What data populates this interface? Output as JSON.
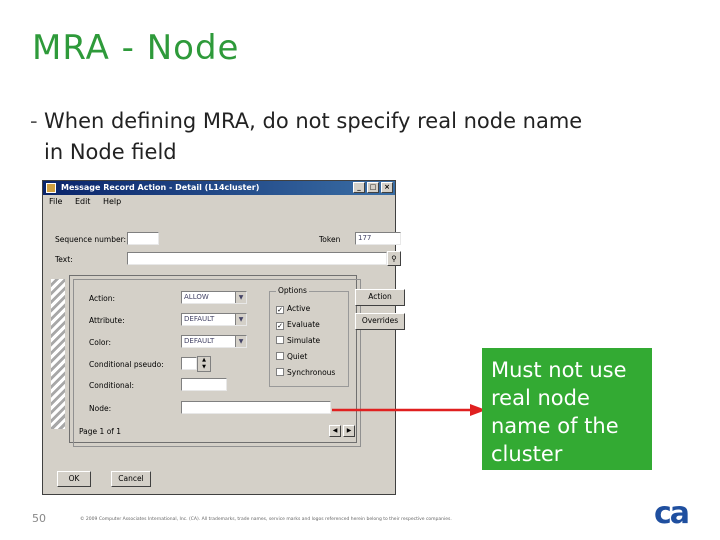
{
  "slide": {
    "title": "MRA - Node",
    "bullet_dash": "-",
    "bullet_line1": "When defining MRA, do not specify real node name",
    "bullet_line2": "in Node field",
    "page_number": "50",
    "footer": "© 2009 Computer Associates International, Inc. (CA). All trademarks, trade names, service marks and logos referenced herein belong to their respective companies.",
    "logo_text": "ca",
    "callout": "Must not use real node name of the cluster"
  },
  "window": {
    "title": "Message Record Action - Detail (L14cluster)",
    "controls": {
      "minimize": "_",
      "maximize": "□",
      "close": "×"
    },
    "menu": [
      "File",
      "Edit",
      "Help"
    ],
    "labels": {
      "sequence_number": "Sequence number:",
      "token": "Token",
      "text": "Text:",
      "action": "Action:",
      "attribute": "Attribute:",
      "color": "Color:",
      "condition_pseudo": "Conditional pseudo:",
      "condition": "Conditional:",
      "node": "Node:",
      "page": "Page 1 of 1"
    },
    "values": {
      "sequence_number": "",
      "token": "177",
      "text": "",
      "action": "ALLOW",
      "attribute": "DEFAULT",
      "color": "DEFAULT",
      "condition": "",
      "node": ""
    },
    "options": {
      "title": "Options",
      "items": [
        {
          "label": "Active",
          "checked": true
        },
        {
          "label": "Evaluate",
          "checked": true
        },
        {
          "label": "Simulate",
          "checked": false
        },
        {
          "label": "Quiet",
          "checked": false
        },
        {
          "label": "Synchronous",
          "checked": false
        }
      ]
    },
    "side_buttons": {
      "action": "Action",
      "overrides": "Overrides"
    },
    "buttons": {
      "ok": "OK",
      "cancel": "Cancel"
    }
  }
}
